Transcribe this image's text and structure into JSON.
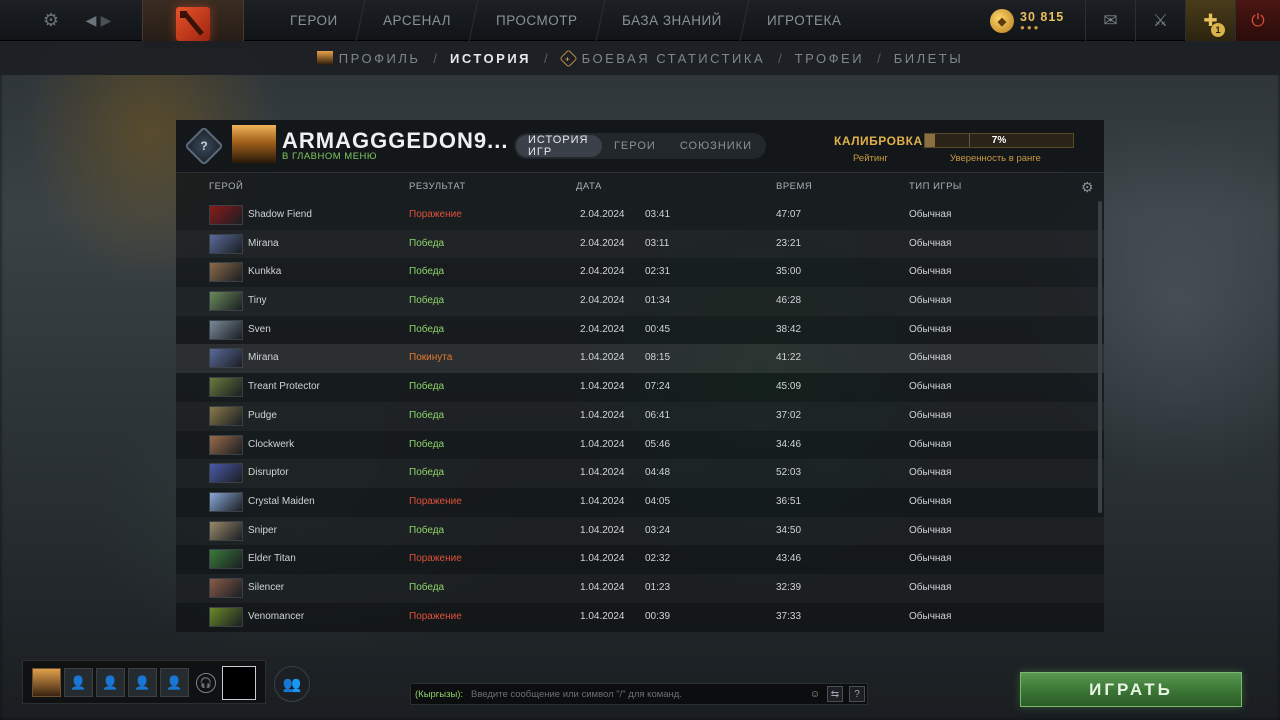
{
  "nav": {
    "items": [
      "ГЕРОИ",
      "АРСЕНАЛ",
      "ПРОСМОТР",
      "БАЗА ЗНАНИЙ",
      "ИГРОТЕКА"
    ],
    "gold": "30 815",
    "notification_count": "1"
  },
  "subnav": {
    "profile": "ПРОФИЛЬ",
    "history": "ИСТОРИЯ",
    "battle_stats": "БОЕВАЯ СТАТИСТИКА",
    "trophies": "ТРОФЕИ",
    "tickets": "БИЛЕТЫ",
    "separator": "/"
  },
  "profile": {
    "rank_symbol": "?",
    "username": "ARMAGGGEDON9...",
    "status": "В ГЛАВНОМ МЕНЮ"
  },
  "tabs": {
    "history": "ИСТОРИЯ ИГР",
    "heroes": "ГЕРОИ",
    "allies": "СОЮЗНИКИ"
  },
  "calibration": {
    "title": "КАЛИБРОВКА",
    "rating_label": "Рейтинг",
    "progress_label": "7%",
    "progress": 0.07,
    "confidence_label": "Уверенность в ранге"
  },
  "columns": {
    "hero": "ГЕРОЙ",
    "result": "РЕЗУЛЬТАТ",
    "date": "ДАТА",
    "duration": "ВРЕМЯ",
    "game_type": "ТИП ИГРЫ"
  },
  "matches": [
    {
      "hero": "Shadow Fiend",
      "result": "Поражение",
      "outcome": "loss",
      "date": "2.04.2024",
      "time": "03:41",
      "duration": "47:07",
      "type": "Обычная",
      "color": "#8a1a1a"
    },
    {
      "hero": "Mirana",
      "result": "Победа",
      "outcome": "win",
      "date": "2.04.2024",
      "time": "03:11",
      "duration": "23:21",
      "type": "Обычная",
      "color": "#5a6a9a"
    },
    {
      "hero": "Kunkka",
      "result": "Победа",
      "outcome": "win",
      "date": "2.04.2024",
      "time": "02:31",
      "duration": "35:00",
      "type": "Обычная",
      "color": "#8a6a4a"
    },
    {
      "hero": "Tiny",
      "result": "Победа",
      "outcome": "win",
      "date": "2.04.2024",
      "time": "01:34",
      "duration": "46:28",
      "type": "Обычная",
      "color": "#6a8a5a"
    },
    {
      "hero": "Sven",
      "result": "Победа",
      "outcome": "win",
      "date": "2.04.2024",
      "time": "00:45",
      "duration": "38:42",
      "type": "Обычная",
      "color": "#7a8a9a"
    },
    {
      "hero": "Mirana",
      "result": "Покинута",
      "outcome": "abandon",
      "date": "1.04.2024",
      "time": "08:15",
      "duration": "41:22",
      "type": "Обычная",
      "color": "#5a6a9a"
    },
    {
      "hero": "Treant Protector",
      "result": "Победа",
      "outcome": "win",
      "date": "1.04.2024",
      "time": "07:24",
      "duration": "45:09",
      "type": "Обычная",
      "color": "#6a7a3a"
    },
    {
      "hero": "Pudge",
      "result": "Победа",
      "outcome": "win",
      "date": "1.04.2024",
      "time": "06:41",
      "duration": "37:02",
      "type": "Обычная",
      "color": "#8a7a4a"
    },
    {
      "hero": "Clockwerk",
      "result": "Победа",
      "outcome": "win",
      "date": "1.04.2024",
      "time": "05:46",
      "duration": "34:46",
      "type": "Обычная",
      "color": "#9a6a4a"
    },
    {
      "hero": "Disruptor",
      "result": "Победа",
      "outcome": "win",
      "date": "1.04.2024",
      "time": "04:48",
      "duration": "52:03",
      "type": "Обычная",
      "color": "#4a5aaa"
    },
    {
      "hero": "Crystal Maiden",
      "result": "Поражение",
      "outcome": "loss",
      "date": "1.04.2024",
      "time": "04:05",
      "duration": "36:51",
      "type": "Обычная",
      "color": "#8aa8d8"
    },
    {
      "hero": "Sniper",
      "result": "Победа",
      "outcome": "win",
      "date": "1.04.2024",
      "time": "03:24",
      "duration": "34:50",
      "type": "Обычная",
      "color": "#9a8a6a"
    },
    {
      "hero": "Elder Titan",
      "result": "Поражение",
      "outcome": "loss",
      "date": "1.04.2024",
      "time": "02:32",
      "duration": "43:46",
      "type": "Обычная",
      "color": "#3a7a3a"
    },
    {
      "hero": "Silencer",
      "result": "Победа",
      "outcome": "win",
      "date": "1.04.2024",
      "time": "01:23",
      "duration": "32:39",
      "type": "Обычная",
      "color": "#8a5a4a"
    },
    {
      "hero": "Venomancer",
      "result": "Поражение",
      "outcome": "loss",
      "date": "1.04.2024",
      "time": "00:39",
      "duration": "37:33",
      "type": "Обычная",
      "color": "#6a8a2a"
    }
  ],
  "chat": {
    "channel": "(Кыргызы):",
    "placeholder": "Введите сообщение или символ \"/\" для команд.",
    "help": "?"
  },
  "play_button": "ИГРАТЬ",
  "icons": [
    "settings-icon",
    "back-icon",
    "forward-icon",
    "dota-logo-icon",
    "mail-icon",
    "armory-icon",
    "power-icon",
    "gear-icon",
    "voice-icon",
    "friends-icon",
    "emoji-icon",
    "chat-options-icon"
  ],
  "colors": {
    "win": "#8ed46a",
    "loss": "#e0503a",
    "abandon": "#e6782a",
    "accent_gold": "#e0b04a",
    "play_green": "#3a7434"
  }
}
